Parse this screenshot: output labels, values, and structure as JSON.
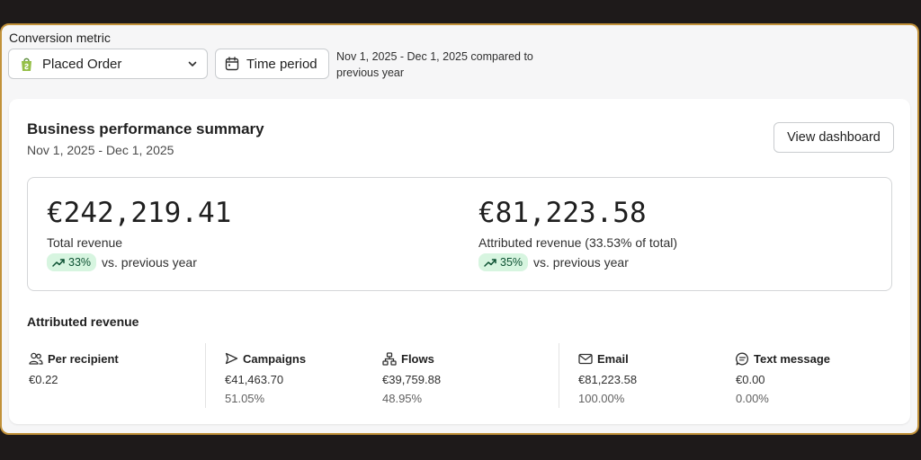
{
  "filters": {
    "conversion_metric_label": "Conversion metric",
    "selected_metric": "Placed Order",
    "time_period_label": "Time period",
    "comparison_text": "Nov 1, 2025 - Dec 1, 2025 compared to previous year"
  },
  "summary": {
    "title": "Business performance summary",
    "date_range": "Nov 1, 2025 - Dec 1, 2025",
    "view_dashboard_label": "View dashboard",
    "total": {
      "value": "€242,219.41",
      "label": "Total revenue",
      "change": "33%",
      "comparison": "vs. previous year"
    },
    "attributed": {
      "value": "€81,223.58",
      "label": "Attributed revenue (33.53% of total)",
      "change": "35%",
      "comparison": "vs. previous year"
    }
  },
  "attributed_revenue": {
    "title": "Attributed revenue",
    "stats": [
      {
        "icon": "users-icon",
        "label": "Per recipient",
        "value": "€0.22",
        "share": ""
      },
      {
        "icon": "send-icon",
        "label": "Campaigns",
        "value": "€41,463.70",
        "share": "51.05%"
      },
      {
        "icon": "flow-icon",
        "label": "Flows",
        "value": "€39,759.88",
        "share": "48.95%"
      },
      {
        "icon": "mail-icon",
        "label": "Email",
        "value": "€81,223.58",
        "share": "100.00%"
      },
      {
        "icon": "message-icon",
        "label": "Text message",
        "value": "€0.00",
        "share": "0.00%"
      }
    ]
  },
  "colors": {
    "accent_border": "#c2923a",
    "trend_badge_bg": "#d7f5e0",
    "trend_badge_text": "#0c5132",
    "shopify_green": "#95bf47"
  }
}
